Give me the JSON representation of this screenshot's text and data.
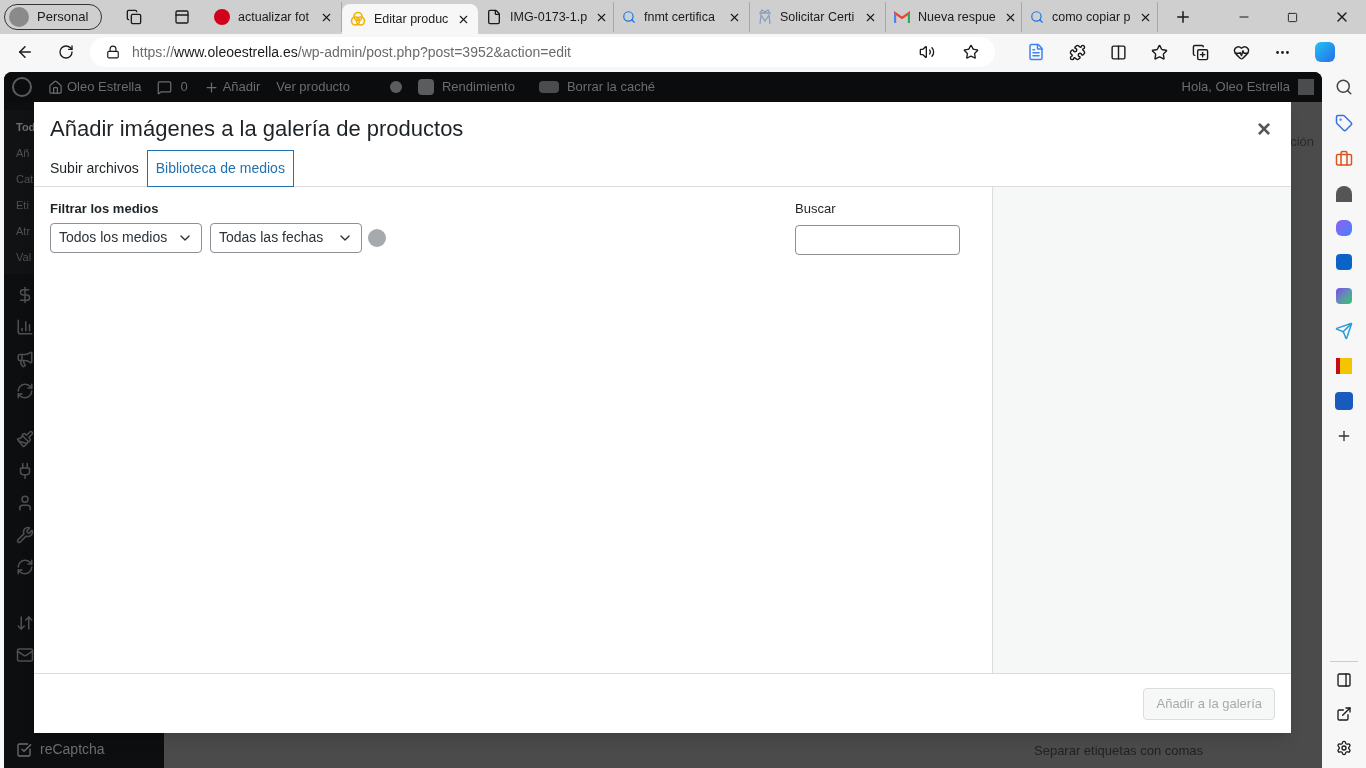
{
  "browser": {
    "profile": "Personal",
    "tabs": [
      {
        "kind": "w",
        "title": "actualizar fot",
        "selected": false
      },
      {
        "kind": "rings",
        "title": "Editar produc",
        "selected": true
      },
      {
        "kind": "file",
        "title": "IMG-0173-1.p",
        "selected": false
      },
      {
        "kind": "search",
        "title": "fnmt certifica",
        "selected": false
      },
      {
        "kind": "seal",
        "title": "Solicitar Certi",
        "selected": false
      },
      {
        "kind": "gmail",
        "title": "Nueva respue",
        "selected": false
      },
      {
        "kind": "search",
        "title": "como copiar p",
        "selected": false
      }
    ],
    "url_scheme": "https://",
    "url_host": "www.oleoestrella.es",
    "url_path": "/wp-admin/post.php?post=3952&action=edit"
  },
  "admin_bar": {
    "site": "Oleo Estrella",
    "comments": "0",
    "new": "Añadir",
    "view": "Ver producto",
    "performance": "Rendimiento",
    "cache": "Borrar la caché",
    "greeting": "Hola, Oleo Estrella"
  },
  "sidebar": {
    "items": [
      "Tod",
      "Añ",
      "Cat",
      "Eti",
      "Atr",
      "Val"
    ],
    "footer_item": "reCaptcha"
  },
  "background": {
    "tab_fragment": "ción",
    "hint": "Separar etiquetas con comas"
  },
  "modal": {
    "title": "Añadir imágenes a la galería de productos",
    "close": "×",
    "tabs": [
      {
        "label": "Subir archivos",
        "selected": false
      },
      {
        "label": "Biblioteca de medios",
        "selected": true
      }
    ],
    "filter_label": "Filtrar los medios",
    "filters": [
      "Todos los medios",
      "Todas las fechas"
    ],
    "search_label": "Buscar",
    "button": {
      "label": "Añadir a la galería",
      "disabled": true
    }
  }
}
